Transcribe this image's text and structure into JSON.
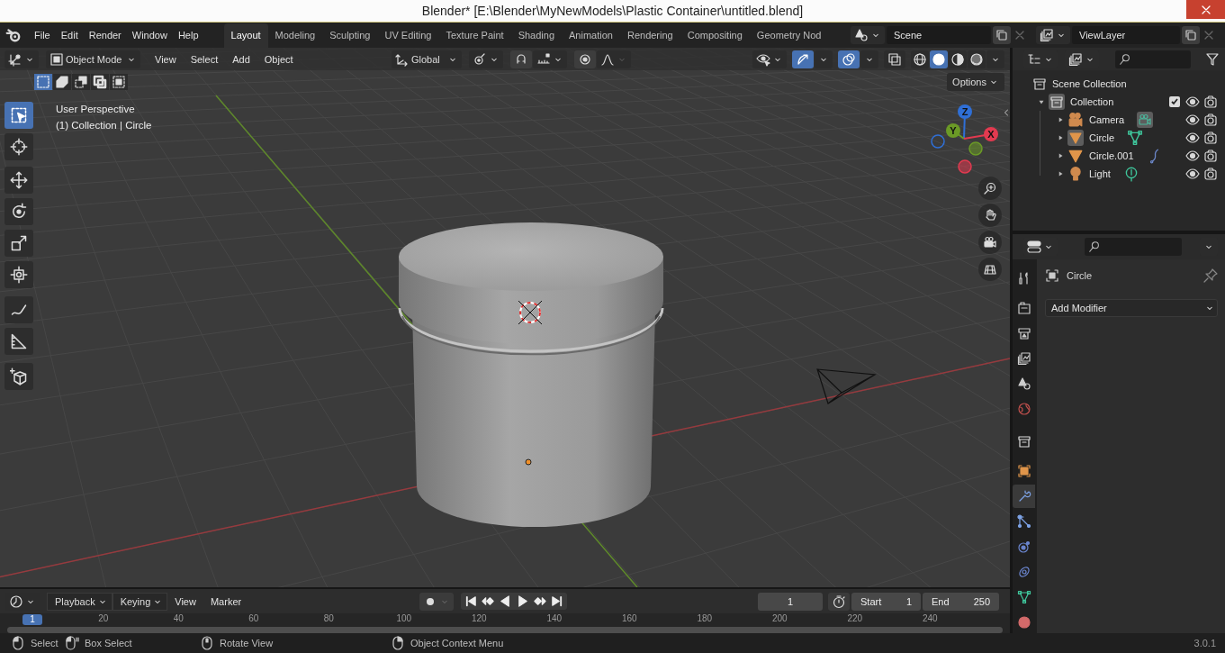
{
  "window": {
    "title": "Blender* [E:\\Blender\\MyNewModels\\Plastic Container\\untitled.blend]"
  },
  "menu": [
    "File",
    "Edit",
    "Render",
    "Window",
    "Help"
  ],
  "workspaces": [
    {
      "label": "Layout",
      "selected": true
    },
    {
      "label": "Modeling",
      "selected": false
    },
    {
      "label": "Sculpting",
      "selected": false
    },
    {
      "label": "UV Editing",
      "selected": false
    },
    {
      "label": "Texture Paint",
      "selected": false
    },
    {
      "label": "Shading",
      "selected": false
    },
    {
      "label": "Animation",
      "selected": false
    },
    {
      "label": "Rendering",
      "selected": false
    },
    {
      "label": "Compositing",
      "selected": false
    },
    {
      "label": "Geometry Nod",
      "selected": false
    }
  ],
  "scene": "Scene",
  "view_layer": "ViewLayer",
  "viewport": {
    "mode": "Object Mode",
    "menus": [
      "View",
      "Select",
      "Add",
      "Object"
    ],
    "orientation": "Global",
    "gizmos": {
      "on": true
    },
    "overlays": {
      "on": true
    },
    "xray": {
      "on": false
    },
    "shading": [
      {
        "kind": "wireframe",
        "selected": false
      },
      {
        "kind": "solid",
        "selected": true
      },
      {
        "kind": "material",
        "selected": false
      },
      {
        "kind": "rendered",
        "selected": false
      }
    ],
    "select_modes": [
      {
        "kind": "set",
        "selected": true
      },
      {
        "kind": "extend",
        "selected": false
      },
      {
        "kind": "subtract",
        "selected": false
      },
      {
        "kind": "invert",
        "selected": false
      },
      {
        "kind": "intersect",
        "selected": false
      }
    ],
    "options": "Options",
    "tool_groups": [
      [
        {
          "kind": "select_box",
          "selected": true
        },
        {
          "kind": "cursor",
          "selected": false
        }
      ],
      [
        {
          "kind": "move",
          "selected": false
        },
        {
          "kind": "rotate",
          "selected": false
        },
        {
          "kind": "scale",
          "selected": false
        },
        {
          "kind": "transform",
          "selected": false
        }
      ],
      [
        {
          "kind": "annotate",
          "selected": false
        },
        {
          "kind": "measure",
          "selected": false
        }
      ],
      [
        {
          "kind": "add_cube",
          "selected": false
        }
      ]
    ],
    "overlay_text": [
      "User Perspective",
      "(1) Collection | Circle"
    ],
    "gizmo": [
      {
        "label": "Z",
        "color": "#2f6fd6"
      },
      {
        "label": "Y",
        "color": "#6b9a26"
      },
      {
        "label": "X",
        "color": "#e23a50"
      }
    ]
  },
  "outliner": {
    "root": "Scene Collection",
    "items": [
      {
        "name": "Collection",
        "kind": "collection",
        "selected": true,
        "expanded": true,
        "checked": true,
        "children": [
          {
            "name": "Camera",
            "kind": "camera",
            "data": {
              "kind": "camera",
              "active": true
            },
            "selected": false,
            "expanded": false
          },
          {
            "name": "Circle",
            "kind": "mesh",
            "data": {
              "kind": "mesh",
              "active": false
            },
            "selected": true,
            "expanded": false
          },
          {
            "name": "Circle.001",
            "kind": "mesh",
            "data": {
              "kind": "curve",
              "active": false
            },
            "selected": false,
            "expanded": false
          },
          {
            "name": "Light",
            "kind": "light",
            "data": {
              "kind": "light",
              "active": false
            },
            "selected": false,
            "expanded": false
          }
        ]
      }
    ]
  },
  "properties": {
    "tabs": [
      {
        "kind": "tool",
        "selected": false
      },
      {
        "kind": "render",
        "selected": false
      },
      {
        "kind": "output",
        "selected": false
      },
      {
        "kind": "view_layer",
        "selected": false
      },
      {
        "kind": "scene",
        "selected": false
      },
      {
        "kind": "world",
        "selected": false
      },
      {
        "kind": "collection",
        "selected": false
      },
      {
        "kind": "object",
        "selected": false
      },
      {
        "kind": "modifiers",
        "selected": true
      },
      {
        "kind": "particles",
        "selected": false
      },
      {
        "kind": "physics",
        "selected": false
      },
      {
        "kind": "constraints",
        "selected": false
      },
      {
        "kind": "data",
        "selected": false
      },
      {
        "kind": "material",
        "selected": false
      }
    ],
    "object": "Circle",
    "add_modifier": "Add Modifier"
  },
  "timeline": {
    "menus": [
      {
        "label": "Playback",
        "kind": "dropdown"
      },
      {
        "label": "Keying",
        "kind": "dropdown"
      },
      {
        "label": "View",
        "kind": "menu"
      },
      {
        "label": "Marker",
        "kind": "menu"
      }
    ],
    "current_frame": "1",
    "start": {
      "label": "Start",
      "value": "1"
    },
    "end": {
      "label": "End",
      "value": "250"
    },
    "playhead": "1",
    "ruler": [
      "20",
      "40",
      "60",
      "80",
      "100",
      "120",
      "140",
      "160",
      "180",
      "200",
      "220",
      "240"
    ]
  },
  "status_bar": {
    "hints": [
      {
        "kind": "left",
        "label": "Select"
      },
      {
        "kind": "drag",
        "label": "Box Select"
      },
      {
        "kind": "middle",
        "label": "Rotate View"
      },
      {
        "kind": "right",
        "label": "Object Context Menu"
      }
    ],
    "version": "3.0.1"
  }
}
